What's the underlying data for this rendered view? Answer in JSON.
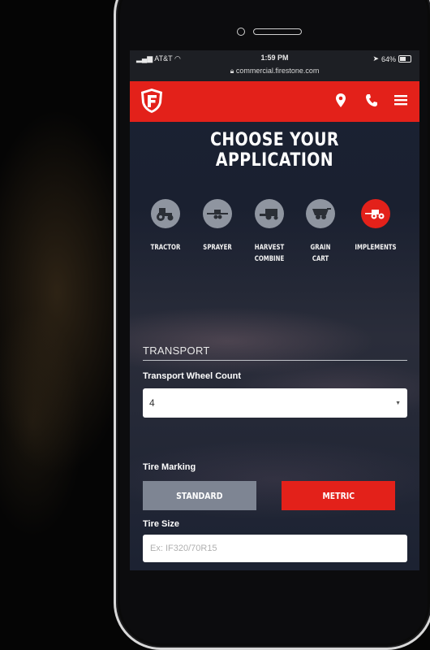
{
  "status": {
    "carrier": "AT&T",
    "time": "1:59 PM",
    "battery": "64%",
    "url": "commercial.firestone.com"
  },
  "header": {
    "logo_letter": "F",
    "brand_color": "#e3211a"
  },
  "page": {
    "title": "CHOOSE YOUR APPLICATION"
  },
  "applications": [
    {
      "label": "TRACTOR",
      "label2": "",
      "icon": "tractor-icon",
      "active": false
    },
    {
      "label": "SPRAYER",
      "label2": "",
      "icon": "sprayer-icon",
      "active": false
    },
    {
      "label": "HARVEST",
      "label2": "COMBINE",
      "icon": "combine-icon",
      "active": false
    },
    {
      "label": "GRAIN",
      "label2": "CART",
      "icon": "grain-cart-icon",
      "active": false
    },
    {
      "label": "IMPLEMENTS",
      "label2": "",
      "icon": "implements-icon",
      "active": true
    }
  ],
  "transport": {
    "section_title": "TRANSPORT",
    "wheel_count_label": "Transport Wheel Count",
    "wheel_count_value": "4"
  },
  "tire_marking": {
    "label": "Tire Marking",
    "options": [
      "STANDARD",
      "METRIC"
    ],
    "selected": "METRIC"
  },
  "tire_size": {
    "label": "Tire Size",
    "placeholder": "Ex: IF320/70R15"
  }
}
